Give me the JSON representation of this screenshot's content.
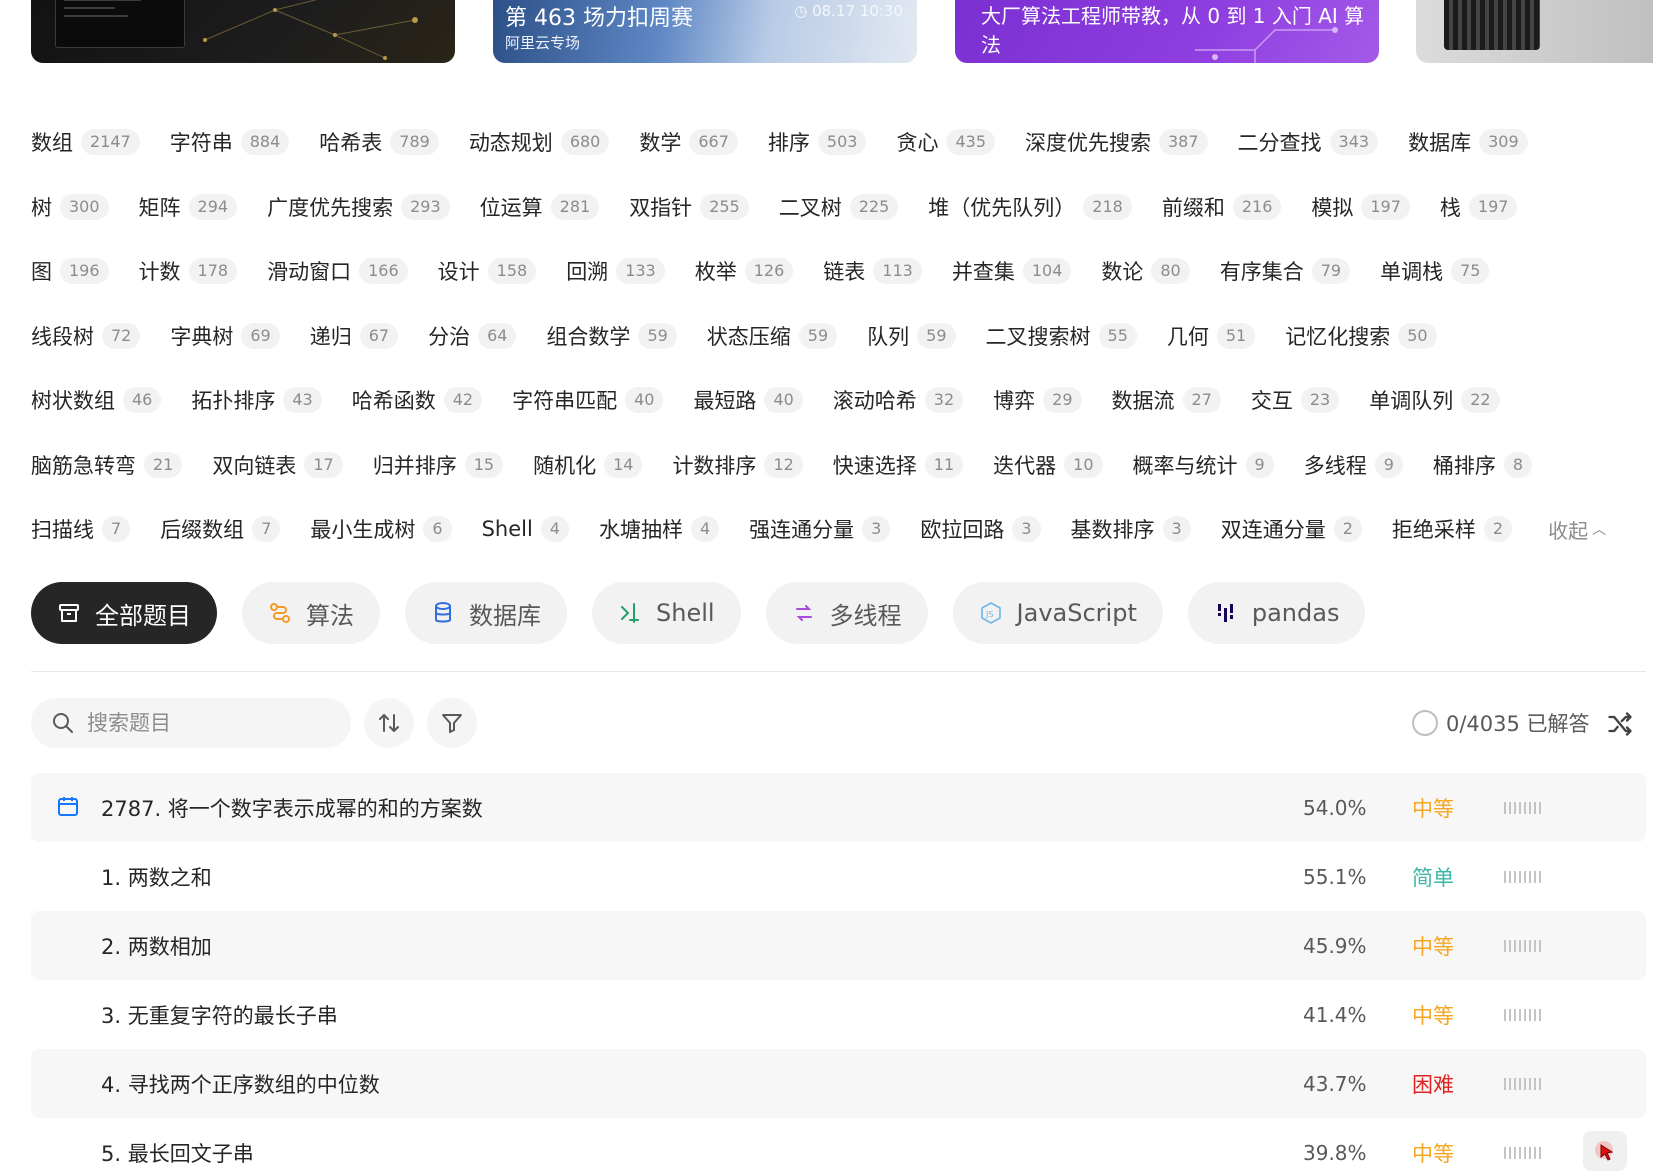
{
  "banners": {
    "contest_title": "第 463 场力扣周赛",
    "contest_sub": "阿里云专场",
    "contest_time": "08.17 10:30",
    "ai_title": "大厂算法工程师带教，从 0 到 1 入门 AI 算法"
  },
  "tag_rows": [
    [
      [
        "数组",
        "2147"
      ],
      [
        "字符串",
        "884"
      ],
      [
        "哈希表",
        "789"
      ],
      [
        "动态规划",
        "680"
      ],
      [
        "数学",
        "667"
      ],
      [
        "排序",
        "503"
      ],
      [
        "贪心",
        "435"
      ],
      [
        "深度优先搜索",
        "387"
      ],
      [
        "二分查找",
        "343"
      ],
      [
        "数据库",
        "309"
      ]
    ],
    [
      [
        "树",
        "300"
      ],
      [
        "矩阵",
        "294"
      ],
      [
        "广度优先搜索",
        "293"
      ],
      [
        "位运算",
        "281"
      ],
      [
        "双指针",
        "255"
      ],
      [
        "二叉树",
        "225"
      ],
      [
        "堆（优先队列）",
        "218"
      ],
      [
        "前缀和",
        "216"
      ],
      [
        "模拟",
        "197"
      ],
      [
        "栈",
        "197"
      ]
    ],
    [
      [
        "图",
        "196"
      ],
      [
        "计数",
        "178"
      ],
      [
        "滑动窗口",
        "166"
      ],
      [
        "设计",
        "158"
      ],
      [
        "回溯",
        "133"
      ],
      [
        "枚举",
        "126"
      ],
      [
        "链表",
        "113"
      ],
      [
        "并查集",
        "104"
      ],
      [
        "数论",
        "80"
      ],
      [
        "有序集合",
        "79"
      ],
      [
        "单调栈",
        "75"
      ]
    ],
    [
      [
        "线段树",
        "72"
      ],
      [
        "字典树",
        "69"
      ],
      [
        "递归",
        "67"
      ],
      [
        "分治",
        "64"
      ],
      [
        "组合数学",
        "59"
      ],
      [
        "状态压缩",
        "59"
      ],
      [
        "队列",
        "59"
      ],
      [
        "二叉搜索树",
        "55"
      ],
      [
        "几何",
        "51"
      ],
      [
        "记忆化搜索",
        "50"
      ]
    ],
    [
      [
        "树状数组",
        "46"
      ],
      [
        "拓扑排序",
        "43"
      ],
      [
        "哈希函数",
        "42"
      ],
      [
        "字符串匹配",
        "40"
      ],
      [
        "最短路",
        "40"
      ],
      [
        "滚动哈希",
        "32"
      ],
      [
        "博弈",
        "29"
      ],
      [
        "数据流",
        "27"
      ],
      [
        "交互",
        "23"
      ],
      [
        "单调队列",
        "22"
      ]
    ],
    [
      [
        "脑筋急转弯",
        "21"
      ],
      [
        "双向链表",
        "17"
      ],
      [
        "归并排序",
        "15"
      ],
      [
        "随机化",
        "14"
      ],
      [
        "计数排序",
        "12"
      ],
      [
        "快速选择",
        "11"
      ],
      [
        "迭代器",
        "10"
      ],
      [
        "概率与统计",
        "9"
      ],
      [
        "多线程",
        "9"
      ],
      [
        "桶排序",
        "8"
      ]
    ],
    [
      [
        "扫描线",
        "7"
      ],
      [
        "后缀数组",
        "7"
      ],
      [
        "最小生成树",
        "6"
      ],
      [
        "Shell",
        "4"
      ],
      [
        "水塘抽样",
        "4"
      ],
      [
        "强连通分量",
        "3"
      ],
      [
        "欧拉回路",
        "3"
      ],
      [
        "基数排序",
        "3"
      ],
      [
        "双连通分量",
        "2"
      ],
      [
        "拒绝采样",
        "2"
      ]
    ]
  ],
  "collapse_label": "收起",
  "categories": [
    {
      "label": "全部题目",
      "icon": "inbox-icon"
    },
    {
      "label": "算法",
      "icon": "algorithm-icon"
    },
    {
      "label": "数据库",
      "icon": "database-icon"
    },
    {
      "label": "Shell",
      "icon": "shell-icon"
    },
    {
      "label": "多线程",
      "icon": "threads-icon"
    },
    {
      "label": "JavaScript",
      "icon": "javascript-icon"
    },
    {
      "label": "pandas",
      "icon": "pandas-icon"
    }
  ],
  "search": {
    "placeholder": "搜索题目"
  },
  "solved": {
    "text": "0/4035 已解答"
  },
  "colors": {
    "easy": "#3eb5a6",
    "medium": "#f5a623",
    "hard": "#e02424",
    "active_category": "#262626"
  },
  "problems": [
    {
      "title": "2787. 将一个数字表示成幂的和的方案数",
      "rate": "54.0%",
      "difficulty": "中等",
      "level": "mid",
      "daily": true
    },
    {
      "title": "1. 两数之和",
      "rate": "55.1%",
      "difficulty": "简单",
      "level": "easy",
      "daily": false
    },
    {
      "title": "2. 两数相加",
      "rate": "45.9%",
      "difficulty": "中等",
      "level": "mid",
      "daily": false
    },
    {
      "title": "3. 无重复字符的最长子串",
      "rate": "41.4%",
      "difficulty": "中等",
      "level": "mid",
      "daily": false
    },
    {
      "title": "4. 寻找两个正序数组的中位数",
      "rate": "43.7%",
      "difficulty": "困难",
      "level": "hard",
      "daily": false
    },
    {
      "title": "5. 最长回文子串",
      "rate": "39.8%",
      "difficulty": "中等",
      "level": "mid",
      "daily": false
    }
  ]
}
